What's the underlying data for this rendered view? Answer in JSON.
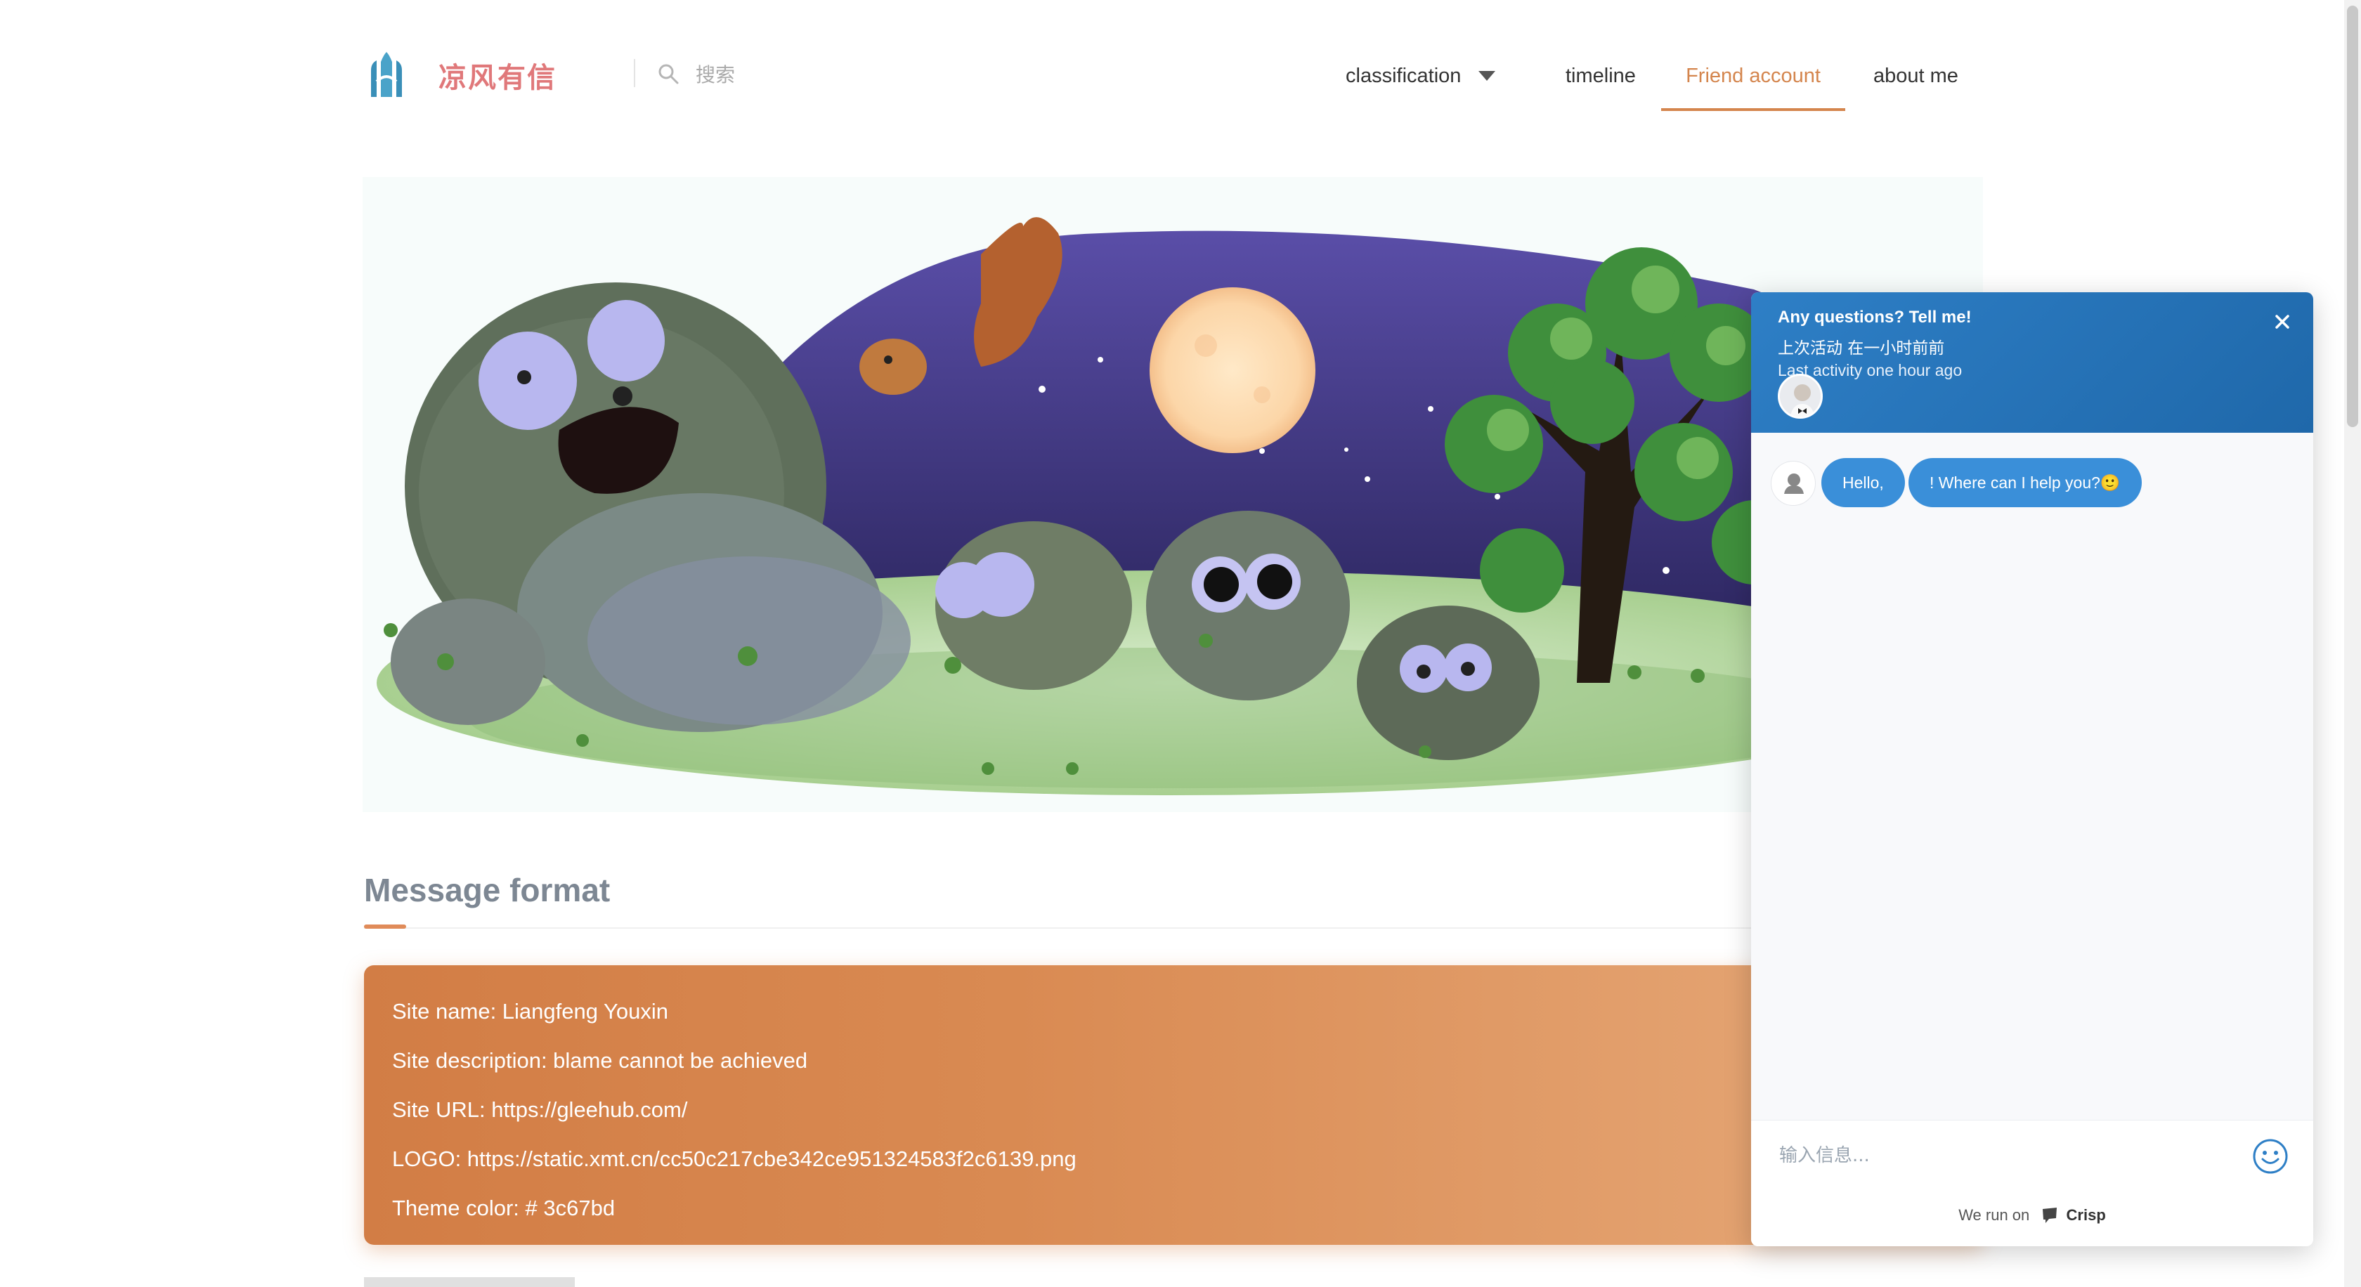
{
  "header": {
    "site_title": "凉风有信",
    "search_placeholder": "搜索",
    "nav": [
      {
        "label": "classification",
        "active": false
      },
      {
        "label": "timeline",
        "active": false
      },
      {
        "label": "Friend account",
        "active": true
      },
      {
        "label": "about me",
        "active": false
      }
    ],
    "accent_color": "#d4854d"
  },
  "section": {
    "title": "Message format"
  },
  "info_card": {
    "lines": [
      "Site name: Liangfeng Youxin",
      "Site description: blame cannot be achieved",
      "Site URL: https://gleehub.com/",
      "LOGO: https://static.xmt.cn/cc50c217cbe342ce951324583f2c6139.png",
      "Theme color: # 3c67bd"
    ],
    "gradient_from": "#d27d45",
    "gradient_to": "#e7aa7a"
  },
  "chat": {
    "title": "Any questions? Tell me!",
    "subtitle_cn": "上次活动 在一小时前前",
    "subtitle_en": "Last activity one hour ago",
    "messages": [
      "Hello,",
      "! Where can I help you?🙂"
    ],
    "input_placeholder": "输入信息...",
    "footer_prefix": "We run on",
    "footer_brand": "Crisp",
    "header_color": "#2e7fc6",
    "bubble_color": "#3a8fd9",
    "icons": [
      "close-icon",
      "emoji-icon",
      "operator-avatar-icon",
      "crisp-logo-icon"
    ]
  }
}
